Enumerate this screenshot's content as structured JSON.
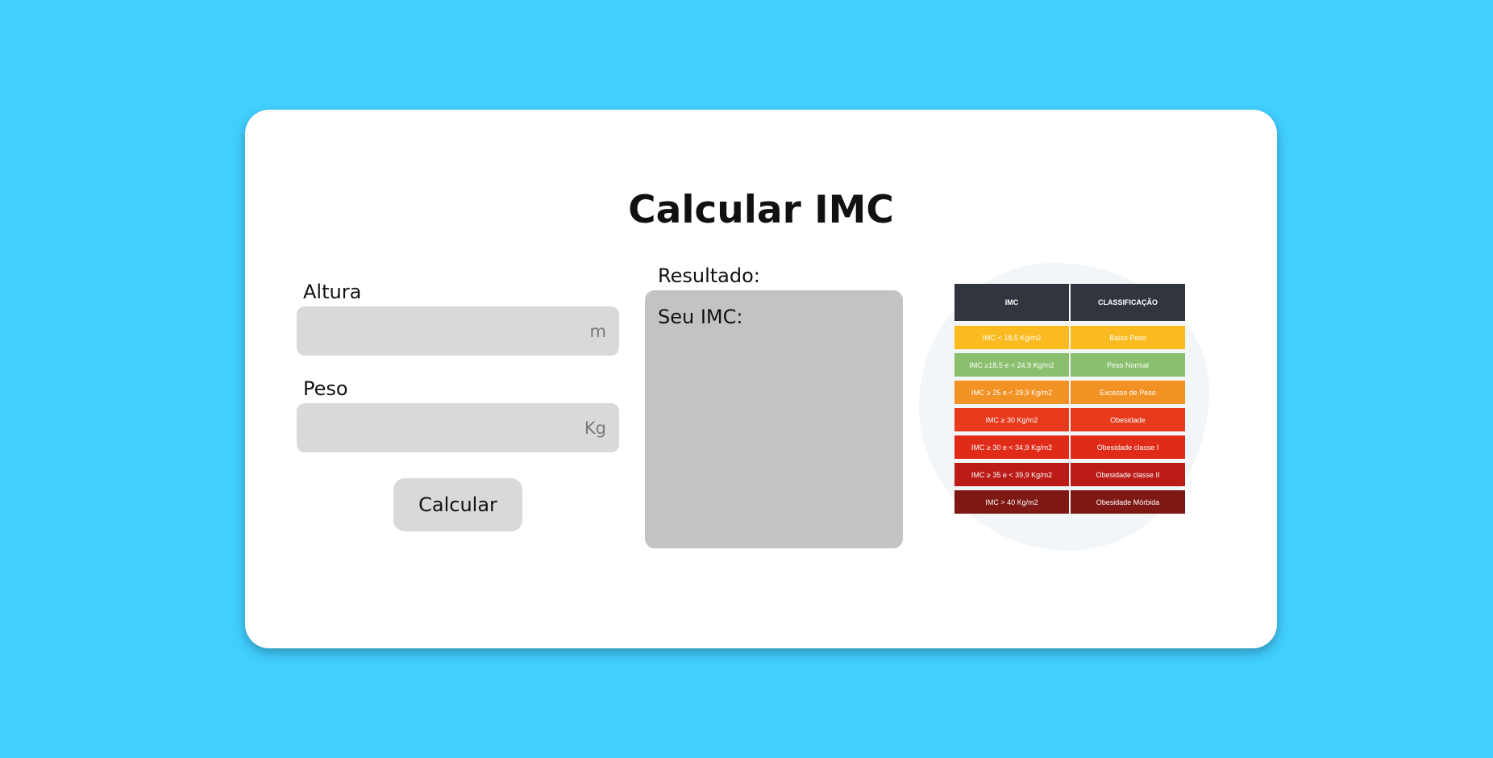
{
  "title": "Calcular IMC",
  "form": {
    "altura_label": "Altura",
    "altura_placeholder": "m",
    "altura_value": "",
    "peso_label": "Peso",
    "peso_placeholder": "Kg",
    "peso_value": "",
    "calc_button_label": "Calcular"
  },
  "result": {
    "label": "Resultado:",
    "text": "Seu IMC:"
  },
  "imc_table": {
    "headers": [
      "IMC",
      "CLASSIFICAÇÃO"
    ],
    "header_color": "#31353d",
    "rows": [
      {
        "imc": "IMC < 18,5 Kg/m2",
        "classification": "Baixo Peso",
        "color": "#fbbb20"
      },
      {
        "imc": "IMC ≥18,5 e < 24,9 Kg/m2",
        "classification": "Peso Normal",
        "color": "#8abf6e"
      },
      {
        "imc": "IMC ≥ 25 e < 29,9 Kg/m2",
        "classification": "Excesso de Peso",
        "color": "#f39224"
      },
      {
        "imc": "IMC ≥ 30 Kg/m2",
        "classification": "Obesidade",
        "color": "#e83a1c"
      },
      {
        "imc": "IMC ≥ 30 e < 34,9 Kg/m2",
        "classification": "Obesidade classe I",
        "color": "#e02b19"
      },
      {
        "imc": "IMC ≥ 35 e < 39,9 Kg/m2",
        "classification": "Obesidade classe II",
        "color": "#bb1c18"
      },
      {
        "imc": "IMC > 40 Kg/m2",
        "classification": "Obesidade Mórbida",
        "color": "#7d1813"
      }
    ]
  },
  "colors": {
    "page_background": "#41cfff",
    "card_background": "#ffffff",
    "input_background": "#d9d9d9",
    "result_background": "#c3c3c3"
  }
}
